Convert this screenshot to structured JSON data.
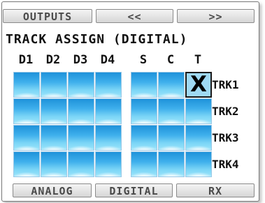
{
  "top_nav": {
    "outputs": "OUTPUTS",
    "prev": "<<",
    "next": ">>"
  },
  "title": "TRACK ASSIGN (DIGITAL)",
  "columns": [
    "D1",
    "D2",
    "D3",
    "D4",
    "S",
    "C",
    "T"
  ],
  "rows": [
    "TRK1",
    "TRK2",
    "TRK3",
    "TRK4"
  ],
  "selected_mark": "X",
  "selected_cell": {
    "row": "TRK1",
    "column": "T"
  },
  "bottom_tabs": {
    "analog": "ANALOG",
    "digital": "DIGITAL",
    "rx": "RX"
  },
  "colors": {
    "button_blue_top": "#1f92da",
    "button_blue_bottom": "#9ee6fb"
  }
}
